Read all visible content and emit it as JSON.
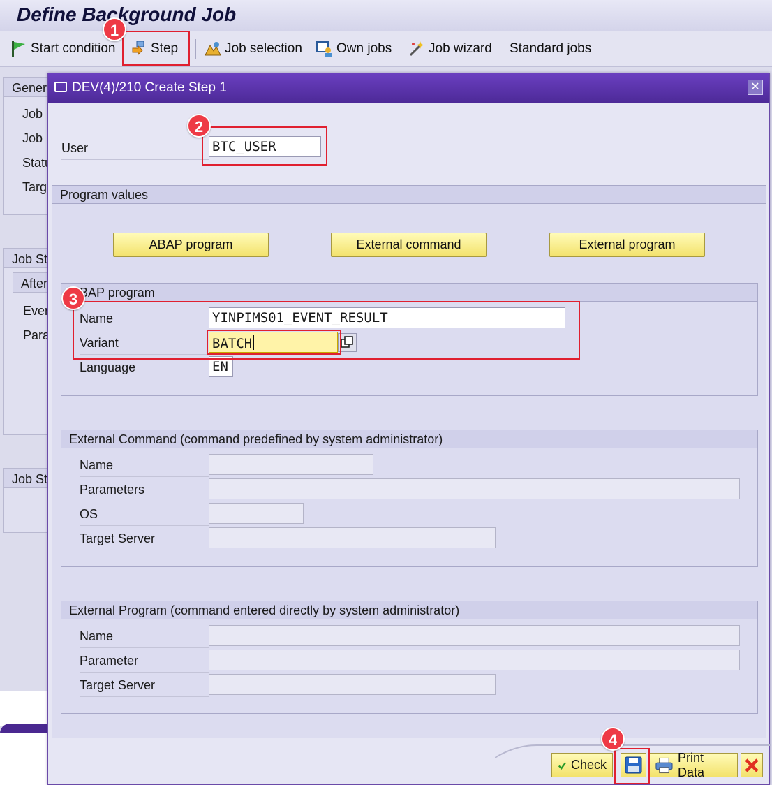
{
  "window": {
    "title": "Define Background Job"
  },
  "toolbar": {
    "start_condition": "Start condition",
    "step": "Step",
    "job_selection": "Job selection",
    "own_jobs": "Own jobs",
    "job_wizard": "Job wizard",
    "standard_jobs": "Standard jobs"
  },
  "background": {
    "general_header": "Gener",
    "job1": "Job",
    "job2": "Job",
    "status": "Statu",
    "target": "Targ",
    "job_start_header": "Job St",
    "after_tab": "After",
    "event": "Ever",
    "param": "Para",
    "job_steps_header": "Job St"
  },
  "dialog": {
    "title": "DEV(4)/210 Create Step  1",
    "user_label": "User",
    "user_value": "BTC_USER",
    "program_values_header": "Program values",
    "abap_program_button": "ABAP program",
    "external_command_button": "External command",
    "external_program_button": "External program",
    "abap_section": {
      "header": "BAP program",
      "name_label": "Name",
      "name_value": "YINPIMS01_EVENT_RESULT",
      "variant_label": "Variant",
      "variant_value": "BATCH",
      "language_label": "Language",
      "language_value": "EN"
    },
    "ext_command_section": {
      "header": "External Command (command predefined by system administrator)",
      "name_label": "Name",
      "parameters_label": "Parameters",
      "os_label": "OS",
      "target_server_label": "Target Server"
    },
    "ext_program_section": {
      "header": "External Program (command entered directly by system administrator)",
      "name_label": "Name",
      "parameter_label": "Parameter",
      "target_server_label": "Target Server"
    },
    "footer": {
      "check": "Check",
      "print_data": "Print Data"
    }
  },
  "annotations": {
    "b1": "1",
    "b2": "2",
    "b3": "3",
    "b4": "4"
  },
  "colors": {
    "dialog_header": "#5a34ad",
    "yellow_button": "#f7eb8a",
    "annotation_red": "#e02030"
  }
}
